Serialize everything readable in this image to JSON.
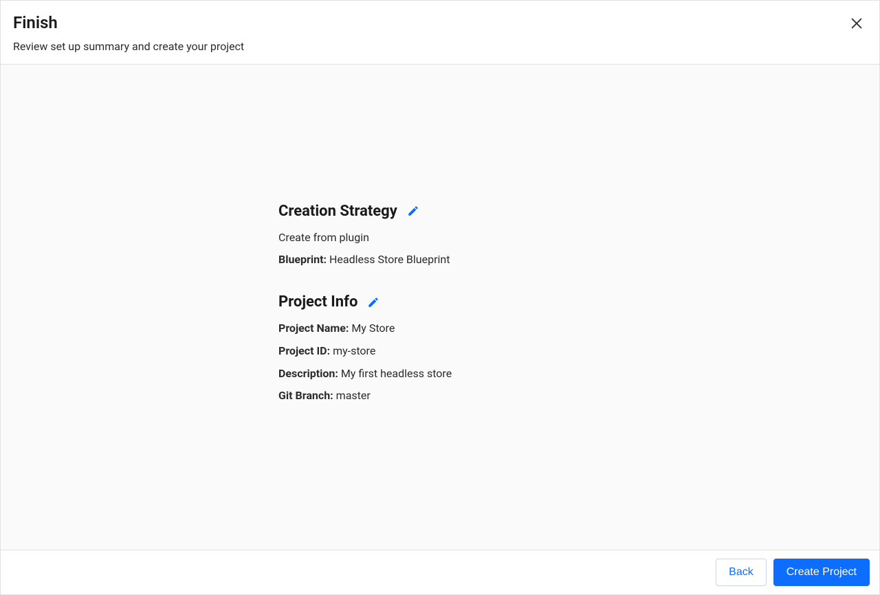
{
  "header": {
    "title": "Finish",
    "subtitle": "Review set up summary and create your project"
  },
  "sections": {
    "creation_strategy": {
      "title": "Creation Strategy",
      "source_text": "Create from plugin",
      "blueprint_label": "Blueprint:",
      "blueprint_value": "Headless Store Blueprint"
    },
    "project_info": {
      "title": "Project Info",
      "name_label": "Project Name:",
      "name_value": "My Store",
      "id_label": "Project ID:",
      "id_value": "my-store",
      "description_label": "Description:",
      "description_value": "My first headless store",
      "branch_label": "Git Branch:",
      "branch_value": "master"
    }
  },
  "footer": {
    "back_label": "Back",
    "create_label": "Create Project"
  },
  "colors": {
    "accent": "#0d6efd",
    "border": "#e0e0e0",
    "text": "#1a1a1a",
    "bg": "#fafafa"
  },
  "icons": {
    "close": "close-icon",
    "edit": "pencil-icon"
  }
}
